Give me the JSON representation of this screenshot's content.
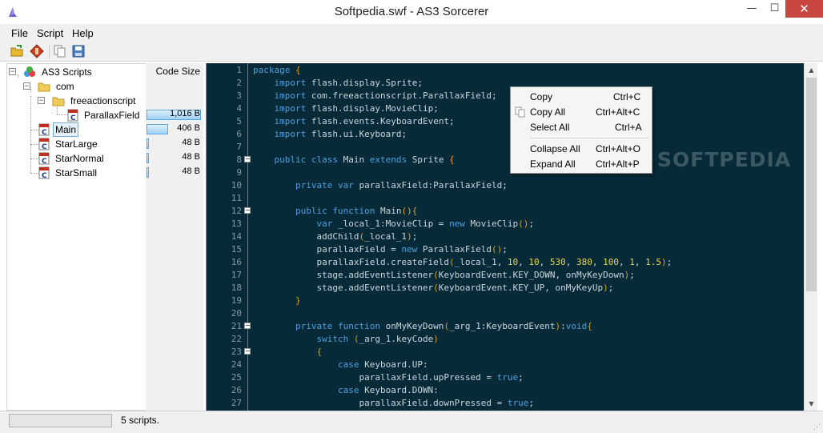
{
  "window": {
    "title": "Softpedia.swf - AS3 Sorcerer",
    "min": "—",
    "max": "☐",
    "close": "✕"
  },
  "menu": [
    "File",
    "Script",
    "Help"
  ],
  "toolbar": {
    "icons": [
      "open-folder-icon",
      "decompile-icon",
      "copy-icon",
      "save-icon"
    ]
  },
  "tree": {
    "items": [
      {
        "label": "AS3 Scripts",
        "icon": "scripts-icon"
      },
      {
        "label": "com",
        "icon": "folder-icon"
      },
      {
        "label": "freeactionscript",
        "icon": "folder-icon"
      },
      {
        "label": "ParallaxField",
        "icon": "class-icon"
      },
      {
        "label": "Main",
        "icon": "class-icon",
        "selected": true
      },
      {
        "label": "StarLarge",
        "icon": "class-icon"
      },
      {
        "label": "StarNormal",
        "icon": "class-icon"
      },
      {
        "label": "StarSmall",
        "icon": "class-icon"
      }
    ]
  },
  "sizes": {
    "header": "Code Size",
    "rows": [
      {
        "value": "1,016 B",
        "fraction": 1.0
      },
      {
        "value": "406 B",
        "fraction": 0.4
      },
      {
        "value": "48 B",
        "fraction": 0.047
      },
      {
        "value": "48 B",
        "fraction": 0.047
      },
      {
        "value": "48 B",
        "fraction": 0.047
      }
    ]
  },
  "code": {
    "line_numbers": [
      "1",
      "2",
      "3",
      "4",
      "5",
      "6",
      "7",
      "8",
      "9",
      "10",
      "11",
      "12",
      "13",
      "14",
      "15",
      "16",
      "17",
      "18",
      "19",
      "20",
      "21",
      "22",
      "23",
      "24",
      "25",
      "26",
      "27"
    ],
    "lines": [
      "package {",
      "    import flash.display.Sprite;",
      "    import com.freeactionscript.ParallaxField;",
      "    import flash.display.MovieClip;",
      "    import flash.events.KeyboardEvent;",
      "    import flash.ui.Keyboard;",
      "",
      "    public class Main extends Sprite {",
      "",
      "        private var parallaxField:ParallaxField;",
      "",
      "        public function Main(){",
      "            var _local_1:MovieClip = new MovieClip();",
      "            addChild(_local_1);",
      "            parallaxField = new ParallaxField();",
      "            parallaxField.createField(_local_1, 10, 10, 530, 380, 100, 1, 1.5);",
      "            stage.addEventListener(KeyboardEvent.KEY_DOWN, onMyKeyDown);",
      "            stage.addEventListener(KeyboardEvent.KEY_UP, onMyKeyUp);",
      "        }",
      "",
      "        private function onMyKeyDown(_arg_1:KeyboardEvent):void{",
      "            switch (_arg_1.keyCode)",
      "            {",
      "                case Keyboard.UP:",
      "                    parallaxField.upPressed = true;",
      "                case Keyboard.DOWN:",
      "                    parallaxField.downPressed = true;"
    ]
  },
  "context_menu": {
    "items": [
      {
        "label": "Copy",
        "shortcut": "Ctrl+C"
      },
      {
        "label": "Copy All",
        "shortcut": "Ctrl+Alt+C"
      },
      {
        "label": "Select All",
        "shortcut": "Ctrl+A"
      },
      {
        "label": "Collapse All",
        "shortcut": "Ctrl+Alt+O"
      },
      {
        "label": "Expand All",
        "shortcut": "Ctrl+Alt+P"
      }
    ]
  },
  "watermark": "SOFTPEDIA",
  "status": {
    "text": "5 scripts."
  }
}
